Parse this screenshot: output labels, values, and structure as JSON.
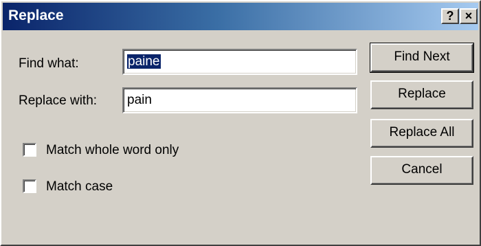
{
  "dialog": {
    "title": "Replace",
    "help_label": "?",
    "close_label": "×"
  },
  "find": {
    "label": "Find what:",
    "value": "paine"
  },
  "replace": {
    "label": "Replace with:",
    "value": "pain"
  },
  "options": {
    "match_whole_word_label": "Match whole word only",
    "match_whole_word_checked": false,
    "match_case_label": "Match case",
    "match_case_checked": false
  },
  "buttons": {
    "find_next": "Find Next",
    "replace": "Replace",
    "replace_all": "Replace All",
    "cancel": "Cancel"
  },
  "colors": {
    "titlebar_start": "#0a246a",
    "titlebar_end": "#a6caf0",
    "face": "#d4d0c8",
    "selection": "#0a246a"
  }
}
